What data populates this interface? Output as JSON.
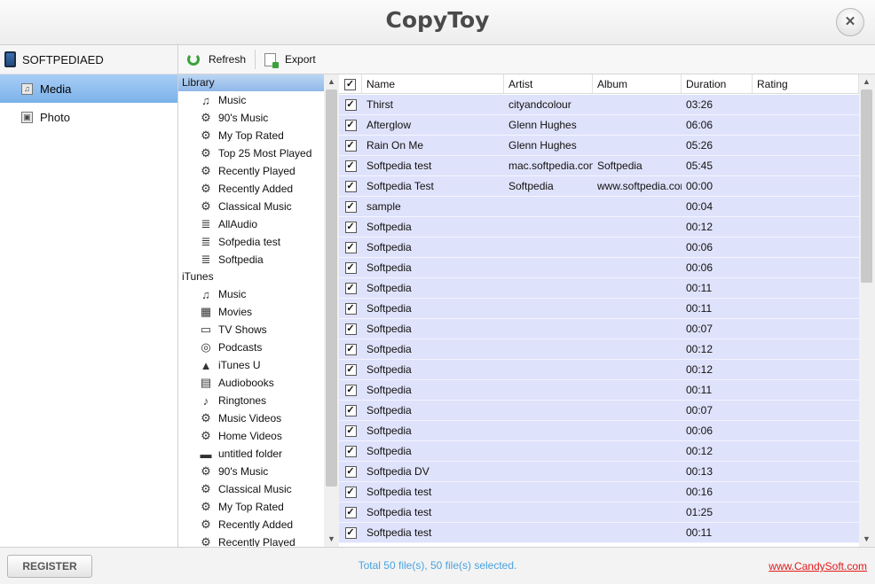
{
  "app": {
    "title": "CopyToy",
    "close_glyph": "✕"
  },
  "device": {
    "name": "SOFTPEDIAED",
    "icon": "phone-icon"
  },
  "nav": [
    {
      "label": "Media",
      "icon": "music-note-icon",
      "active": true
    },
    {
      "label": "Photo",
      "icon": "photo-icon",
      "active": false
    }
  ],
  "toolbar": {
    "refresh_label": "Refresh",
    "export_label": "Export"
  },
  "tree": {
    "library_header": "Library",
    "library_items": [
      {
        "label": "Music",
        "icon": "♫"
      },
      {
        "label": "90's Music",
        "icon": "⚙"
      },
      {
        "label": "My Top Rated",
        "icon": "⚙"
      },
      {
        "label": "Top 25 Most Played",
        "icon": "⚙"
      },
      {
        "label": "Recently Played",
        "icon": "⚙"
      },
      {
        "label": "Recently Added",
        "icon": "⚙"
      },
      {
        "label": "Classical Music",
        "icon": "⚙"
      },
      {
        "label": "AllAudio",
        "icon": "≣"
      },
      {
        "label": "Sofpedia test",
        "icon": "≣"
      },
      {
        "label": "Softpedia",
        "icon": "≣"
      }
    ],
    "itunes_header": "iTunes",
    "itunes_items": [
      {
        "label": "Music",
        "icon": "♫"
      },
      {
        "label": "Movies",
        "icon": "▦"
      },
      {
        "label": "TV Shows",
        "icon": "▭"
      },
      {
        "label": "Podcasts",
        "icon": "◎"
      },
      {
        "label": "iTunes U",
        "icon": "▲"
      },
      {
        "label": "Audiobooks",
        "icon": "▤"
      },
      {
        "label": "Ringtones",
        "icon": "♪"
      },
      {
        "label": "Music Videos",
        "icon": "⚙"
      },
      {
        "label": "Home Videos",
        "icon": "⚙"
      },
      {
        "label": "untitled folder",
        "icon": "▬"
      },
      {
        "label": "90's Music",
        "icon": "⚙"
      },
      {
        "label": "Classical Music",
        "icon": "⚙"
      },
      {
        "label": "My Top Rated",
        "icon": "⚙"
      },
      {
        "label": "Recently Added",
        "icon": "⚙"
      },
      {
        "label": "Recently Played",
        "icon": "⚙"
      }
    ]
  },
  "table": {
    "columns": [
      "Name",
      "Artist",
      "Album",
      "Duration",
      "Rating"
    ],
    "rows": [
      {
        "name": "Thirst",
        "artist": "cityandcolour",
        "album": "",
        "duration": "03:26",
        "rating": ""
      },
      {
        "name": "Afterglow",
        "artist": "Glenn Hughes",
        "album": "",
        "duration": "06:06",
        "rating": ""
      },
      {
        "name": "Rain On Me",
        "artist": "Glenn Hughes",
        "album": "",
        "duration": "05:26",
        "rating": ""
      },
      {
        "name": "Softpedia test",
        "artist": "mac.softpedia.com",
        "album": "Softpedia",
        "duration": "05:45",
        "rating": ""
      },
      {
        "name": "Softpedia Test",
        "artist": "Softpedia",
        "album": "www.softpedia.com",
        "duration": "00:00",
        "rating": ""
      },
      {
        "name": "sample",
        "artist": "",
        "album": "",
        "duration": "00:04",
        "rating": ""
      },
      {
        "name": "Softpedia",
        "artist": "",
        "album": "",
        "duration": "00:12",
        "rating": ""
      },
      {
        "name": "Softpedia",
        "artist": "",
        "album": "",
        "duration": "00:06",
        "rating": ""
      },
      {
        "name": "Softpedia",
        "artist": "",
        "album": "",
        "duration": "00:06",
        "rating": ""
      },
      {
        "name": "Softpedia",
        "artist": "",
        "album": "",
        "duration": "00:11",
        "rating": ""
      },
      {
        "name": "Softpedia",
        "artist": "",
        "album": "",
        "duration": "00:11",
        "rating": ""
      },
      {
        "name": "Softpedia",
        "artist": "",
        "album": "",
        "duration": "00:07",
        "rating": ""
      },
      {
        "name": "Softpedia",
        "artist": "",
        "album": "",
        "duration": "00:12",
        "rating": ""
      },
      {
        "name": "Softpedia",
        "artist": "",
        "album": "",
        "duration": "00:12",
        "rating": ""
      },
      {
        "name": "Softpedia",
        "artist": "",
        "album": "",
        "duration": "00:11",
        "rating": ""
      },
      {
        "name": "Softpedia",
        "artist": "",
        "album": "",
        "duration": "00:07",
        "rating": ""
      },
      {
        "name": "Softpedia",
        "artist": "",
        "album": "",
        "duration": "00:06",
        "rating": ""
      },
      {
        "name": "Softpedia",
        "artist": "",
        "album": "",
        "duration": "00:12",
        "rating": ""
      },
      {
        "name": "Softpedia DV",
        "artist": "",
        "album": "",
        "duration": "00:13",
        "rating": ""
      },
      {
        "name": "Softpedia test",
        "artist": "",
        "album": "",
        "duration": "00:16",
        "rating": ""
      },
      {
        "name": "Softpedia test",
        "artist": "",
        "album": "",
        "duration": "01:25",
        "rating": ""
      },
      {
        "name": "Softpedia test",
        "artist": "",
        "album": "",
        "duration": "00:11",
        "rating": ""
      }
    ]
  },
  "status": {
    "register_label": "REGISTER",
    "summary": "Total 50 file(s), 50 file(s) selected.",
    "link": "www.CandySoft.com"
  },
  "colors": {
    "row_selected": "#dfe2fb",
    "nav_active": "#7cb2ea",
    "status_text": "#4aa3df",
    "link": "#e21a1a",
    "accent_green": "#3aa23a"
  }
}
